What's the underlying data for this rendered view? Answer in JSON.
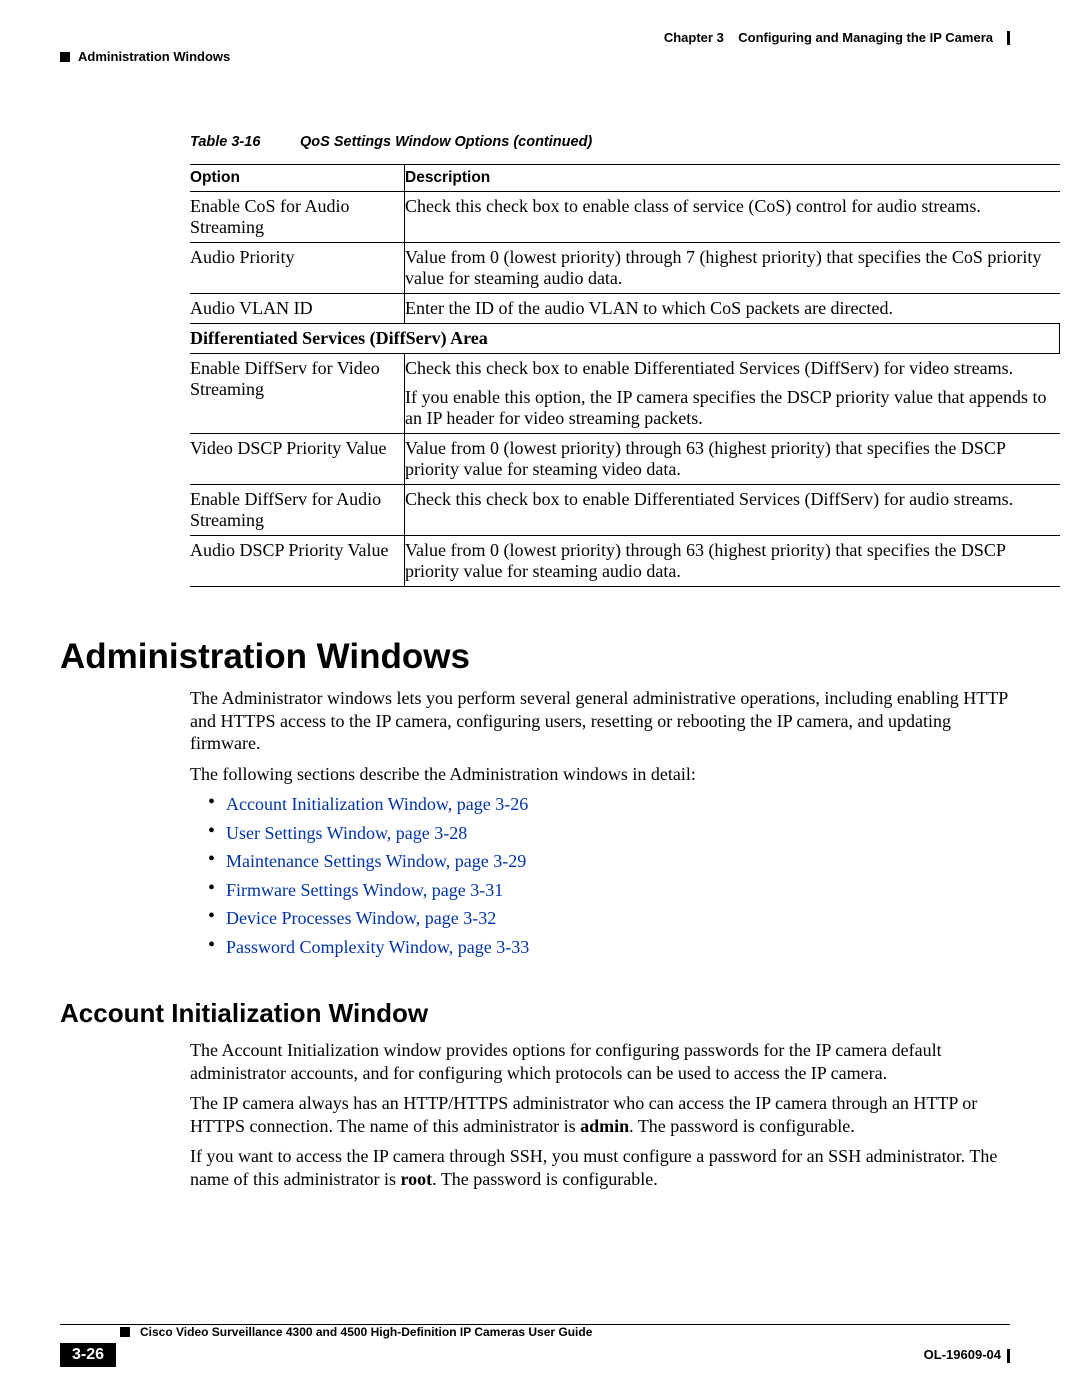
{
  "header": {
    "chapter": "Chapter 3",
    "chapter_title": "Configuring and Managing the IP Camera",
    "section": "Administration Windows"
  },
  "table": {
    "caption_label": "Table 3-16",
    "caption_title": "QoS Settings Window Options (continued)",
    "col1": "Option",
    "col2": "Description",
    "rows": [
      {
        "opt": "Enable CoS for Audio Streaming",
        "desc": "Check this check box to enable class of service (CoS) control for audio streams."
      },
      {
        "opt": "Audio Priority",
        "desc": "Value from 0 (lowest priority) through 7 (highest priority) that specifies the CoS priority value for steaming audio data."
      },
      {
        "opt": "Audio VLAN ID",
        "desc": "Enter the ID of the audio VLAN to which CoS packets are directed."
      }
    ],
    "section_title": "Differentiated Services (DiffServ) Area",
    "rows2": [
      {
        "opt": "Enable DiffServ for Video Streaming",
        "desc": "Check this check box to enable Differentiated Services (DiffServ) for video streams.",
        "desc2": "If you enable this option, the IP camera specifies the DSCP priority value that appends to an IP header for video streaming packets."
      },
      {
        "opt": "Video DSCP Priority Value",
        "desc": "Value from 0 (lowest priority) through 63 (highest priority) that specifies the DSCP priority value for steaming video data."
      },
      {
        "opt": "Enable DiffServ for Audio Streaming",
        "desc": "Check this check box to enable Differentiated Services (DiffServ) for audio streams."
      },
      {
        "opt": "Audio DSCP Priority Value",
        "desc": "Value from 0 (lowest priority) through 63 (highest priority) that specifies the DSCP priority value for steaming audio data."
      }
    ]
  },
  "h1": "Administration Windows",
  "p1": "The Administrator windows lets you perform several general administrative operations, including enabling HTTP and HTTPS access to the IP camera, configuring users, resetting or rebooting the IP camera, and updating firmware.",
  "p2": "The following sections describe the Administration windows in detail:",
  "links": [
    "Account Initialization Window, page 3-26",
    "User Settings Window, page 3-28",
    "Maintenance Settings Window, page 3-29",
    "Firmware Settings Window, page 3-31",
    "Device Processes Window, page 3-32",
    "Password Complexity Window, page 3-33"
  ],
  "h2": "Account Initialization Window",
  "p3": "The Account Initialization window provides options for configuring passwords for the IP camera default administrator accounts, and for configuring which protocols can be used to access the IP camera.",
  "p4a": "The IP camera always has an HTTP/HTTPS administrator who can access the IP camera through an HTTP or HTTPS connection. The name of this administrator is ",
  "p4b": "admin",
  "p4c": ". The password is configurable.",
  "p5a": "If you want to access the IP camera through SSH, you must configure a password for an SSH administrator. The name of this administrator is ",
  "p5b": "root",
  "p5c": ". The password is configurable.",
  "footer": {
    "guide": "Cisco Video Surveillance 4300 and 4500 High-Definition IP Cameras User Guide",
    "page": "3-26",
    "docid": "OL-19609-04"
  }
}
